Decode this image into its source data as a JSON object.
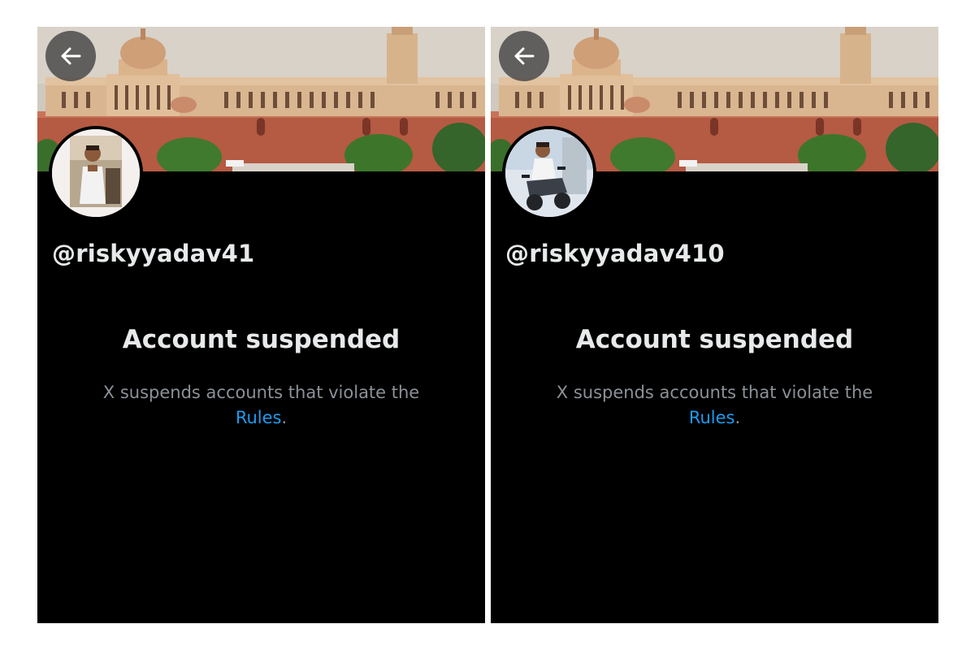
{
  "colors": {
    "panel_background": "#000000",
    "page_background": "#ffffff",
    "text_primary": "#e7e9ea",
    "text_secondary": "#8b9197",
    "link": "#1d9bf0",
    "back_button_bg": "#464646"
  },
  "icons": {
    "back": "arrow-left-icon"
  },
  "profiles": [
    {
      "handle": "@riskyyadav41",
      "headline": "Account suspended",
      "body_text": "X suspends accounts that violate the",
      "link_text": "Rules",
      "trailing": "."
    },
    {
      "handle": "@riskyyadav410",
      "headline": "Account suspended",
      "body_text": "X suspends accounts that violate the",
      "link_text": "Rules",
      "trailing": "."
    }
  ]
}
